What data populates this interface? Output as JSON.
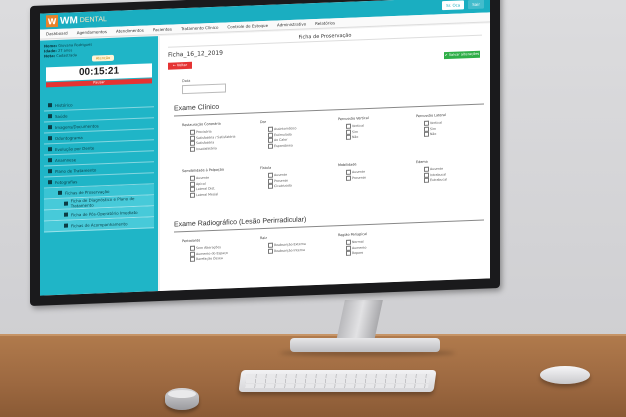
{
  "app": {
    "logo_mark": "W",
    "logo_wm": "WM",
    "logo_dental": "DENTAL",
    "top_actions": [
      "Sr. Oca",
      "Sair"
    ]
  },
  "nav": [
    "Dashboard",
    "Agendamentos",
    "Atendimentos",
    "Pacientes",
    "Tratamento Clínico",
    "Controle de Estoque",
    "Administrativo",
    "Relatórios"
  ],
  "patient": {
    "name_label": "Nome:",
    "name_value": "Giovana Rodrigues",
    "age_label": "Idade:",
    "age_value": "27 anos",
    "note_label": "Nota:",
    "note_value": "Cadastrada",
    "status_badge": "Atenção"
  },
  "timer": {
    "value": "00:15:21",
    "pause_label": "Pausar"
  },
  "sidebar_menu": [
    {
      "label": "Histórico",
      "level": 0
    },
    {
      "label": "Saúde",
      "level": 0
    },
    {
      "label": "Imagens/Documentos",
      "level": 0
    },
    {
      "label": "Odontograma",
      "level": 0
    },
    {
      "label": "Evolução por Dente",
      "level": 0
    },
    {
      "label": "Anamnese",
      "level": 0
    },
    {
      "label": "Plano de Tratamento",
      "level": 0
    },
    {
      "label": "Fotografias",
      "level": 0
    },
    {
      "label": "Fichas de Proservação",
      "level": 1
    },
    {
      "label": "Ficha de Diagnóstico e Plano de Tratamento",
      "level": 2
    },
    {
      "label": "Ficha de Pós-Operatório Imediato",
      "level": 2
    },
    {
      "label": "Fichas de Acompanhamento",
      "level": 2
    }
  ],
  "main": {
    "title": "Ficha de Proservação",
    "record_title": "Ficha_16_12_2019",
    "back_button": "← Voltar",
    "save_button": "✔ Salvar alterações",
    "date_label": "Data",
    "section_clinical": "Exame Clínico",
    "section_radiographic": "Exame Radiográfico (Lesão Perirradicular)",
    "clinical_questions": [
      {
        "label": "Restauração Coronária",
        "options": [
          "Provisória",
          "Satisfatória / Satisfatória",
          "Satisfatória",
          "Insatisfatória"
        ]
      },
      {
        "label": "Dor",
        "options": [
          "Assintomático",
          "Estimulada",
          "Ao Calor",
          "Espontânea"
        ]
      },
      {
        "label": "Percussão Vertical",
        "options": [
          "Vertical",
          "Sim",
          "Não"
        ]
      },
      {
        "label": "Percussão Lateral",
        "options": [
          "Vertical",
          "Sim",
          "Não"
        ]
      },
      {
        "label": "Sensibilidade à Palpação",
        "options": [
          "Ausente",
          "Apical",
          "Lateral Dist.",
          "Lateral Mesial"
        ]
      },
      {
        "label": "Fístula",
        "options": [
          "Ausente",
          "Presente",
          "Cicatrizada"
        ]
      },
      {
        "label": "Mobilidade",
        "options": [
          "Ausente",
          "Presente"
        ]
      },
      {
        "label": "Edema",
        "options": [
          "Ausente",
          "Intrabucal",
          "Extrabucal"
        ]
      }
    ],
    "radiographic_questions": [
      {
        "label": "Periodonto",
        "options": [
          "Sem Alterações",
          "Aumento do Espaço",
          "Rarefação Óssea"
        ]
      },
      {
        "label": "Raiz",
        "options": [
          "Reabsorção Externa",
          "Reabsorção Interna"
        ]
      },
      {
        "label": "Região Periapical",
        "options": [
          "Normal",
          "Aumento",
          "Reparo"
        ]
      }
    ]
  }
}
